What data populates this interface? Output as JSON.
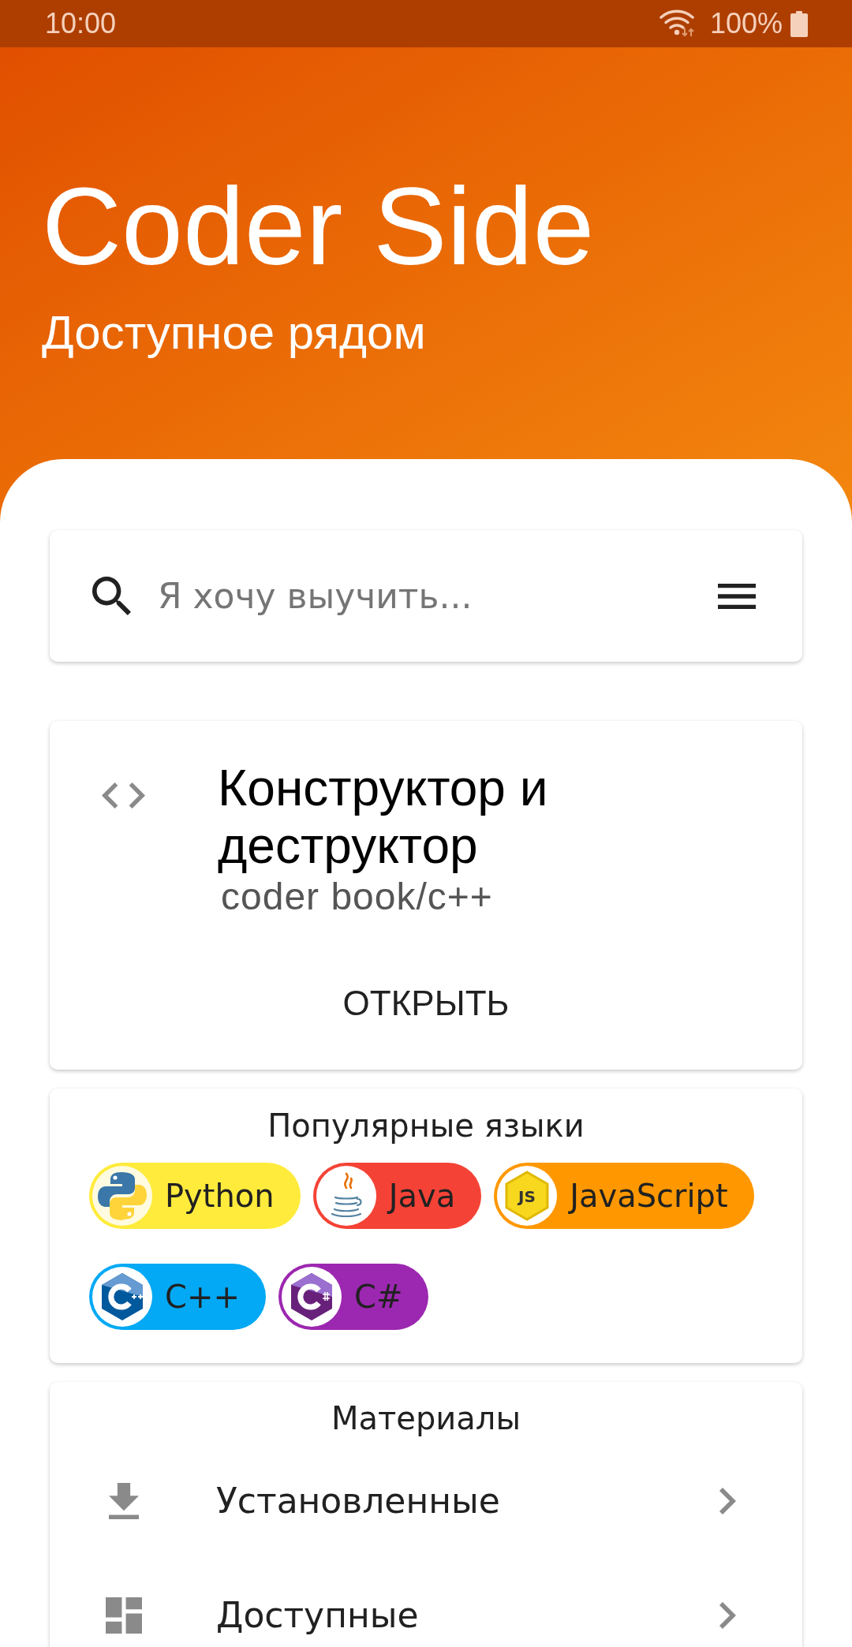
{
  "status_bar": {
    "time": "10:00",
    "battery": "100%"
  },
  "header": {
    "title": "Coder Side",
    "subtitle": "Доступное рядом"
  },
  "search": {
    "placeholder": "Я хочу выучить..."
  },
  "featured": {
    "title": "Конструктор и деструктор",
    "path": "coder book/c++",
    "button": "ОТКРЫТЬ"
  },
  "languages": {
    "title": "Популярные языки",
    "chips": [
      {
        "label": "Python",
        "color": "#ffeb3b"
      },
      {
        "label": "Java",
        "color": "#f44336"
      },
      {
        "label": "JavaScript",
        "color": "#ff9800",
        "logo_text": "JS"
      },
      {
        "label": "C++",
        "color": "#03a9f4"
      },
      {
        "label": "C#",
        "color": "#9c27b0"
      }
    ]
  },
  "materials": {
    "title": "Материалы",
    "items": [
      {
        "label": "Установленные"
      },
      {
        "label": "Доступные"
      }
    ]
  }
}
